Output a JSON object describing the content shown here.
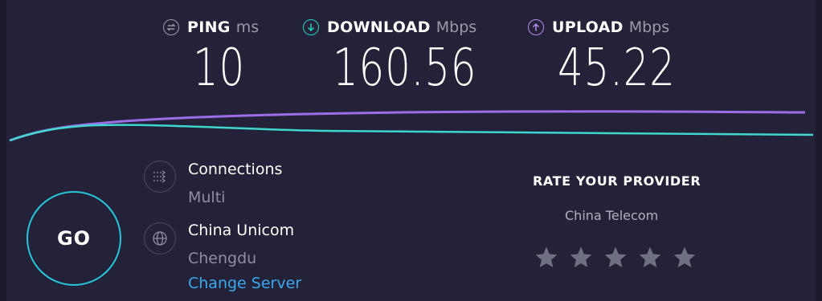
{
  "metrics": {
    "ping": {
      "name": "PING",
      "unit": "ms",
      "value": "10",
      "icon": "ping-icon",
      "color": "#9a99ad"
    },
    "download": {
      "name": "DOWNLOAD",
      "unit": "Mbps",
      "value": "160.56",
      "icon": "download-arrow-icon",
      "color": "#26d3c4"
    },
    "upload": {
      "name": "UPLOAD",
      "unit": "Mbps",
      "value": "45.22",
      "icon": "upload-arrow-icon",
      "color": "#b68cf0"
    }
  },
  "go_button": {
    "label": "GO",
    "color": "#26c6da"
  },
  "connections": {
    "title": "Connections",
    "value": "Multi",
    "icon": "connections-icon"
  },
  "server": {
    "isp": "China Unicom",
    "location": "Chengdu",
    "change_label": "Change Server",
    "icon": "globe-icon"
  },
  "rate": {
    "title": "RATE YOUR PROVIDER",
    "provider": "China Telecom",
    "stars": 5,
    "star_color": "#707083"
  },
  "graph": {
    "download_color": "#3fd7d0",
    "upload_color": "#9b6ee8"
  }
}
